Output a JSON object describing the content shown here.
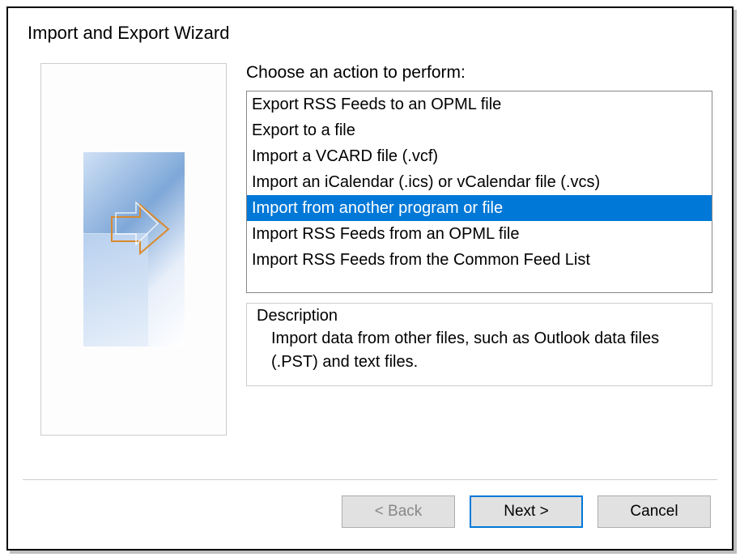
{
  "dialog": {
    "title": "Import and Export Wizard"
  },
  "main": {
    "prompt": "Choose an action to perform:",
    "items": [
      "Export RSS Feeds to an OPML file",
      "Export to a file",
      "Import a VCARD file (.vcf)",
      "Import an iCalendar (.ics) or vCalendar file (.vcs)",
      "Import from another program or file",
      "Import RSS Feeds from an OPML file",
      "Import RSS Feeds from the Common Feed List"
    ],
    "selected_index": 4,
    "description_label": "Description",
    "description_text": "Import data from other files, such as Outlook data files (.PST) and text files."
  },
  "buttons": {
    "back": "< Back",
    "next": "Next >",
    "cancel": "Cancel"
  }
}
